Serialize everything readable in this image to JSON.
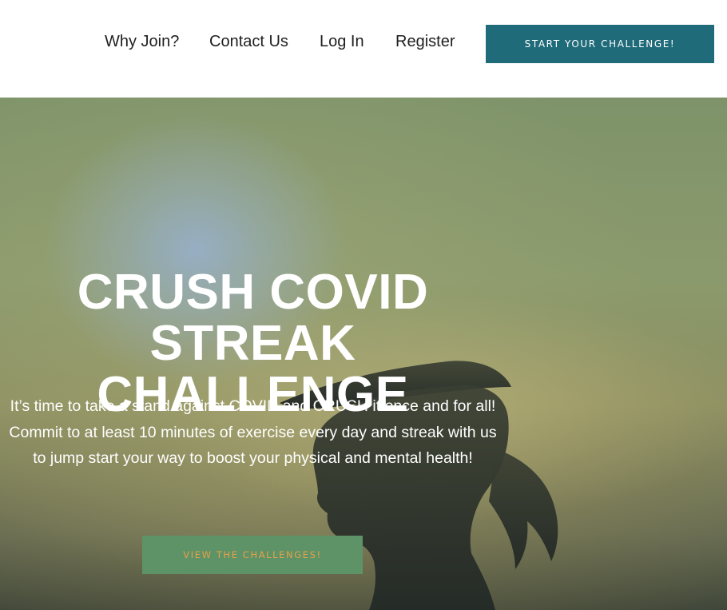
{
  "nav": {
    "items": [
      {
        "label": "Why Join?"
      },
      {
        "label": "Contact Us"
      },
      {
        "label": "Log In"
      },
      {
        "label": "Register"
      }
    ],
    "cta_label": "START YOUR CHALLENGE!"
  },
  "hero": {
    "title_lines": [
      "CRUSH COVID",
      "STREAK CHALLENGE"
    ],
    "body_lines": [
      "It’s time to take a stand against COVID and CRUSH it once and for all!",
      "Commit to at least 10 minutes of exercise every day and streak with us",
      "to jump start your way to boost your physical and mental health!"
    ],
    "cta_label": "VIEW THE CHALLENGES!"
  },
  "colors": {
    "header_cta_bg": "#1f6b7a",
    "header_cta_text": "#ffffff",
    "hero_cta_bg": "#5e9368",
    "hero_cta_text": "#e8a048",
    "nav_text": "#1f1f1f"
  }
}
